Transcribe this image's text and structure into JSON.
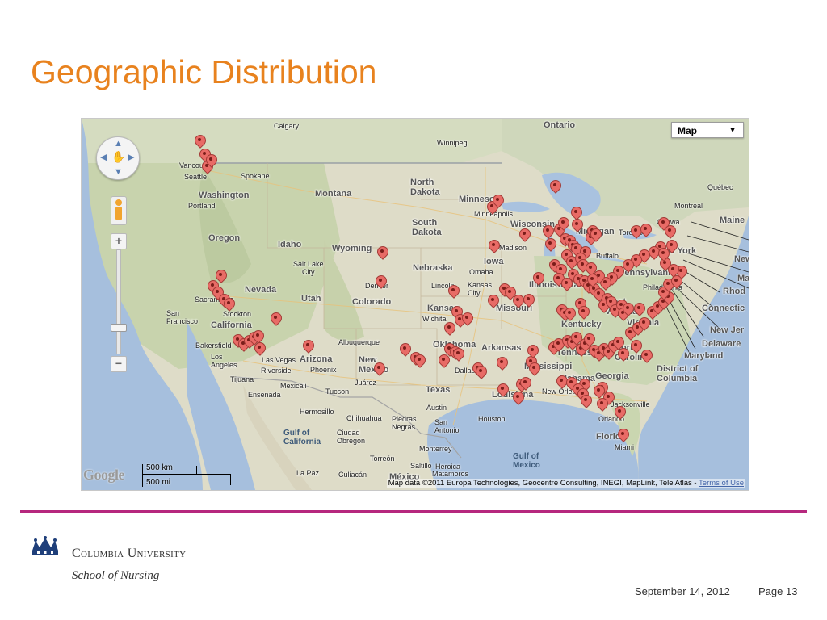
{
  "slide": {
    "title": "Geographic Distribution"
  },
  "map": {
    "map_type_label": "Map",
    "map_type_dropdown_icon": "triangle-down-icon",
    "logo_text": "Google",
    "scale": {
      "km_label": "500 km",
      "mi_label": "500 mi"
    },
    "attribution": "Map data ©2011 Europa Technologies, Geocentre Consulting, INEGI, MapLink, Tele Atlas -",
    "terms_link": "Terms of Use",
    "zoom_in_label": "+",
    "zoom_out_label": "−",
    "pin_color": "#e86b66",
    "labels": {
      "calgary": "Calgary",
      "ontario": "Ontario",
      "winnipeg": "Winnipeg",
      "vancouver": "Vancouver",
      "seattle": "Seattle",
      "spokane": "Spokane",
      "washington": "Washington",
      "montana": "Montana",
      "north_dakota": "North\nDakota",
      "minnesota": "Minnesota",
      "minneapolis": "Minneapolis",
      "wisconsin": "Wisconsin",
      "michigan": "Michigan",
      "toronto": "Toronto",
      "ottawa": "Ottawa",
      "montreal": "Montréal",
      "quebec": "Québec",
      "maine": "Maine",
      "portland": "Portland",
      "oregon": "Oregon",
      "idaho": "Idaho",
      "wyoming": "Wyoming",
      "south_dakota": "South\nDakota",
      "madison": "Madison",
      "iowa": "Iowa",
      "nebraska": "Nebraska",
      "omaha": "Omaha",
      "lincoln": "Lincoln",
      "kansas_city": "Kansas\nCity",
      "illinois": "Illinois",
      "indiana": "Indiana",
      "buffalo": "Buffalo",
      "new_york": "New York",
      "pennsylvania": "Pennsylvania",
      "philadelphia": "Philadelphia",
      "salt_lake_city": "Salt Lake\nCity",
      "nevada": "Nevada",
      "utah": "Utah",
      "colorado": "Colorado",
      "denver": "Denver",
      "sacramento": "Sacramento",
      "san_francisco": "San\nFrancisco",
      "stockton": "Stockton",
      "california": "California",
      "kansas": "Kansas",
      "wichita": "Wichita",
      "missouri": "Missouri",
      "kentucky": "Kentucky",
      "west_virginia": "West\nVirginia",
      "virginia": "Virginia",
      "north_carolina": "North\nCarolina",
      "bakersfield": "Bakersfield",
      "los_angeles": "Los\nAngeles",
      "las_vegas": "Las Vegas",
      "albuquerque": "Albuquerque",
      "oklahoma": "Oklahoma",
      "arkansas": "Arkansas",
      "tennessee": "Tennessee",
      "arizona": "Arizona",
      "phoenix": "Phoenix",
      "new_mexico": "New\nMexico",
      "riverside": "Riverside",
      "tijuana": "Tijuana",
      "mexicali": "Mexicali",
      "tucson": "Tucson",
      "juarez": "Juárez",
      "dallas": "Dallas",
      "mississippi": "Mississippi",
      "alabama": "Alabama",
      "georgia": "Georgia",
      "ensenada": "Ensenada",
      "texas": "Texas",
      "austin": "Austin",
      "san_antonio": "San\nAntonio",
      "houston": "Houston",
      "louisiana": "Louisiana",
      "new_orleans": "New Orleans",
      "jacksonville": "Jacksonville",
      "orlando": "Orlando",
      "florida": "Florida",
      "miami": "Miami",
      "hermosillo": "Hermosillo",
      "chihuahua": "Chihuahua",
      "piedras_negras": "Piedras\nNegras",
      "monterrey": "Monterrey",
      "saltillo": "Saltillo",
      "matamoros": "Matamoros",
      "heroica_matamoros": "Heroica",
      "gulf_of_california": "Gulf of\nCalifornia",
      "ciudad_obregon": "Ciudad\nObregón",
      "torreon": "Torreón",
      "gulf_of_mexico": "Gulf of\nMexico",
      "la_paz": "La Paz",
      "culiacan": "Culiacán",
      "mexico": "México",
      "rhode_island": "Rhod",
      "connecticut": "Connectic",
      "new_jersey": "New Jer",
      "delaware": "Delaware",
      "maryland": "Maryland",
      "district_of_columbia": "District of\nColumbia",
      "massachusetts": "Ma",
      "new_hampshire": "New"
    }
  },
  "footer": {
    "university": "Columbia University",
    "school": "School of Nursing",
    "date": "September 14, 2012",
    "page": "Page 13",
    "rule_color": "#b6287e"
  }
}
